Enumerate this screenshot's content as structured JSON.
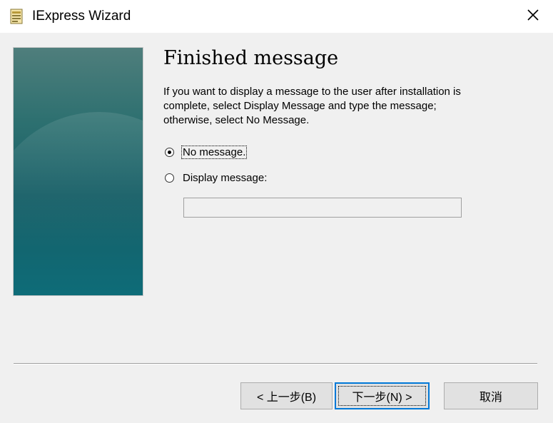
{
  "window": {
    "title": "IExpress Wizard",
    "icon": "iexpress-app-icon",
    "close_icon": "close-icon"
  },
  "page": {
    "heading": "Finished message",
    "description": "If you want to display a message to the user after installation is complete, select Display Message and type the message; otherwise, select No Message."
  },
  "options": {
    "no_message": {
      "label": "No message.",
      "selected": true
    },
    "display_message": {
      "label": "Display message:",
      "selected": false
    }
  },
  "message_input": {
    "value": "",
    "enabled": false
  },
  "buttons": {
    "back": "< 上一步(B)",
    "next": "下一步(N) >",
    "cancel": "取消"
  }
}
